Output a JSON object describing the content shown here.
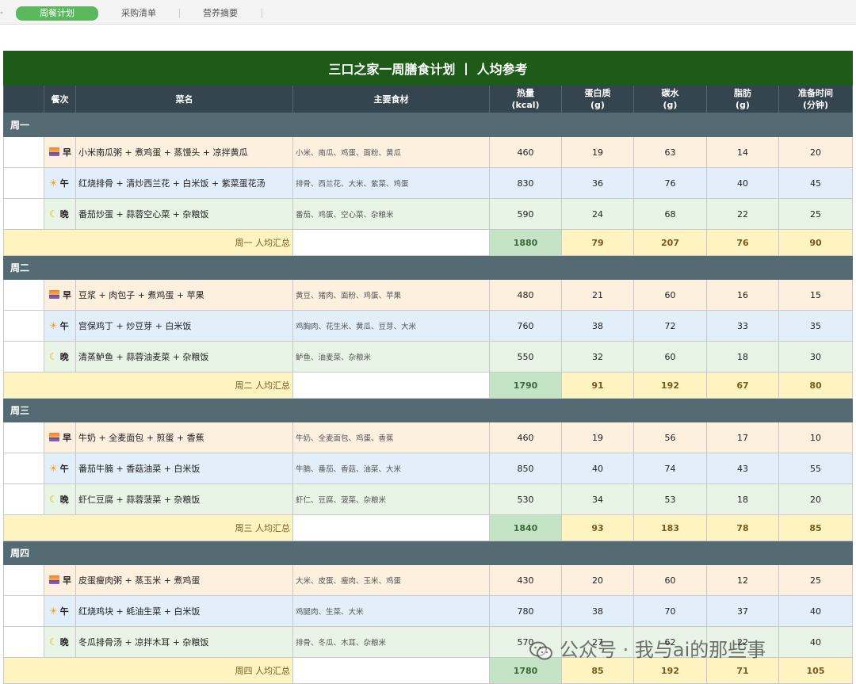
{
  "tabs": [
    {
      "label": "周餐计划"
    },
    {
      "label": "采购清单"
    },
    {
      "label": "营养摘要"
    }
  ],
  "title": "三口之家一周膳食计划 丨 人均参考",
  "headers": {
    "meal": "餐次",
    "dish": "菜名",
    "ingredients": "主要食材",
    "calories": "热量",
    "calories_unit": "(kcal)",
    "protein": "蛋白质",
    "protein_unit": "(g)",
    "carbs": "碳水",
    "carbs_unit": "(g)",
    "fat": "脂肪",
    "fat_unit": "(g)",
    "prep": "准备时间",
    "prep_unit": "(分钟)"
  },
  "days": [
    {
      "name": "周一",
      "meals": [
        {
          "type": "早",
          "icon": "sunrise-icon",
          "dish": "小米南瓜粥 + 煮鸡蛋 + 蒸馒头 + 凉拌黄瓜",
          "ingredients": "小米、南瓜、鸡蛋、面粉、黄瓜",
          "cal": "460",
          "protein": "19",
          "carbs": "63",
          "fat": "14",
          "prep": "20"
        },
        {
          "type": "午",
          "icon": "sun-icon",
          "dish": "红烧排骨 + 清炒西兰花 + 白米饭 + 紫菜蛋花汤",
          "ingredients": "排骨、西兰花、大米、紫菜、鸡蛋",
          "cal": "830",
          "protein": "36",
          "carbs": "76",
          "fat": "40",
          "prep": "45"
        },
        {
          "type": "晚",
          "icon": "moon-icon",
          "dish": "番茄炒蛋 + 蒜蓉空心菜 + 杂粮饭",
          "ingredients": "番茄、鸡蛋、空心菜、杂粮米",
          "cal": "590",
          "protein": "24",
          "carbs": "68",
          "fat": "22",
          "prep": "25"
        }
      ],
      "summary": {
        "label": "周一 人均汇总",
        "cal": "1880",
        "protein": "79",
        "carbs": "207",
        "fat": "76",
        "prep": "90"
      }
    },
    {
      "name": "周二",
      "meals": [
        {
          "type": "早",
          "icon": "sunrise-icon",
          "dish": "豆浆 + 肉包子 + 煮鸡蛋 + 苹果",
          "ingredients": "黄豆、猪肉、面粉、鸡蛋、苹果",
          "cal": "480",
          "protein": "21",
          "carbs": "60",
          "fat": "16",
          "prep": "15"
        },
        {
          "type": "午",
          "icon": "sun-icon",
          "dish": "宫保鸡丁 + 炒豆芽 + 白米饭",
          "ingredients": "鸡胸肉、花生米、黄瓜、豆芽、大米",
          "cal": "760",
          "protein": "38",
          "carbs": "72",
          "fat": "33",
          "prep": "35"
        },
        {
          "type": "晚",
          "icon": "moon-icon",
          "dish": "清蒸鲈鱼 + 蒜蓉油麦菜 + 杂粮饭",
          "ingredients": "鲈鱼、油麦菜、杂粮米",
          "cal": "550",
          "protein": "32",
          "carbs": "60",
          "fat": "18",
          "prep": "30"
        }
      ],
      "summary": {
        "label": "周二 人均汇总",
        "cal": "1790",
        "protein": "91",
        "carbs": "192",
        "fat": "67",
        "prep": "80"
      }
    },
    {
      "name": "周三",
      "meals": [
        {
          "type": "早",
          "icon": "sunrise-icon",
          "dish": "牛奶 + 全麦面包 + 煎蛋 + 香蕉",
          "ingredients": "牛奶、全麦面包、鸡蛋、香蕉",
          "cal": "460",
          "protein": "19",
          "carbs": "56",
          "fat": "17",
          "prep": "10"
        },
        {
          "type": "午",
          "icon": "sun-icon",
          "dish": "番茄牛腩 + 香菇油菜 + 白米饭",
          "ingredients": "牛腩、番茄、香菇、油菜、大米",
          "cal": "850",
          "protein": "40",
          "carbs": "74",
          "fat": "43",
          "prep": "55"
        },
        {
          "type": "晚",
          "icon": "moon-icon",
          "dish": "虾仁豆腐 + 蒜蓉菠菜 + 杂粮饭",
          "ingredients": "虾仁、豆腐、菠菜、杂粮米",
          "cal": "530",
          "protein": "34",
          "carbs": "53",
          "fat": "18",
          "prep": "20"
        }
      ],
      "summary": {
        "label": "周三 人均汇总",
        "cal": "1840",
        "protein": "93",
        "carbs": "183",
        "fat": "78",
        "prep": "85"
      }
    },
    {
      "name": "周四",
      "meals": [
        {
          "type": "早",
          "icon": "sunrise-icon",
          "dish": "皮蛋瘦肉粥 + 蒸玉米 + 煮鸡蛋",
          "ingredients": "大米、皮蛋、瘦肉、玉米、鸡蛋",
          "cal": "430",
          "protein": "20",
          "carbs": "60",
          "fat": "12",
          "prep": "25"
        },
        {
          "type": "午",
          "icon": "sun-icon",
          "dish": "红烧鸡块 + 蚝油生菜 + 白米饭",
          "ingredients": "鸡腿肉、生菜、大米",
          "cal": "780",
          "protein": "38",
          "carbs": "70",
          "fat": "37",
          "prep": "40"
        },
        {
          "type": "晚",
          "icon": "moon-icon",
          "dish": "冬瓜排骨汤 + 凉拌木耳 + 杂粮饭",
          "ingredients": "排骨、冬瓜、木耳、杂粮米",
          "cal": "570",
          "protein": "27",
          "carbs": "62",
          "fat": "22",
          "prep": "40"
        }
      ],
      "summary": {
        "label": "周四 人均汇总",
        "cal": "1780",
        "protein": "85",
        "carbs": "192",
        "fat": "71",
        "prep": "105"
      }
    }
  ],
  "watermark": "公众号 · 我与ai的那些事"
}
